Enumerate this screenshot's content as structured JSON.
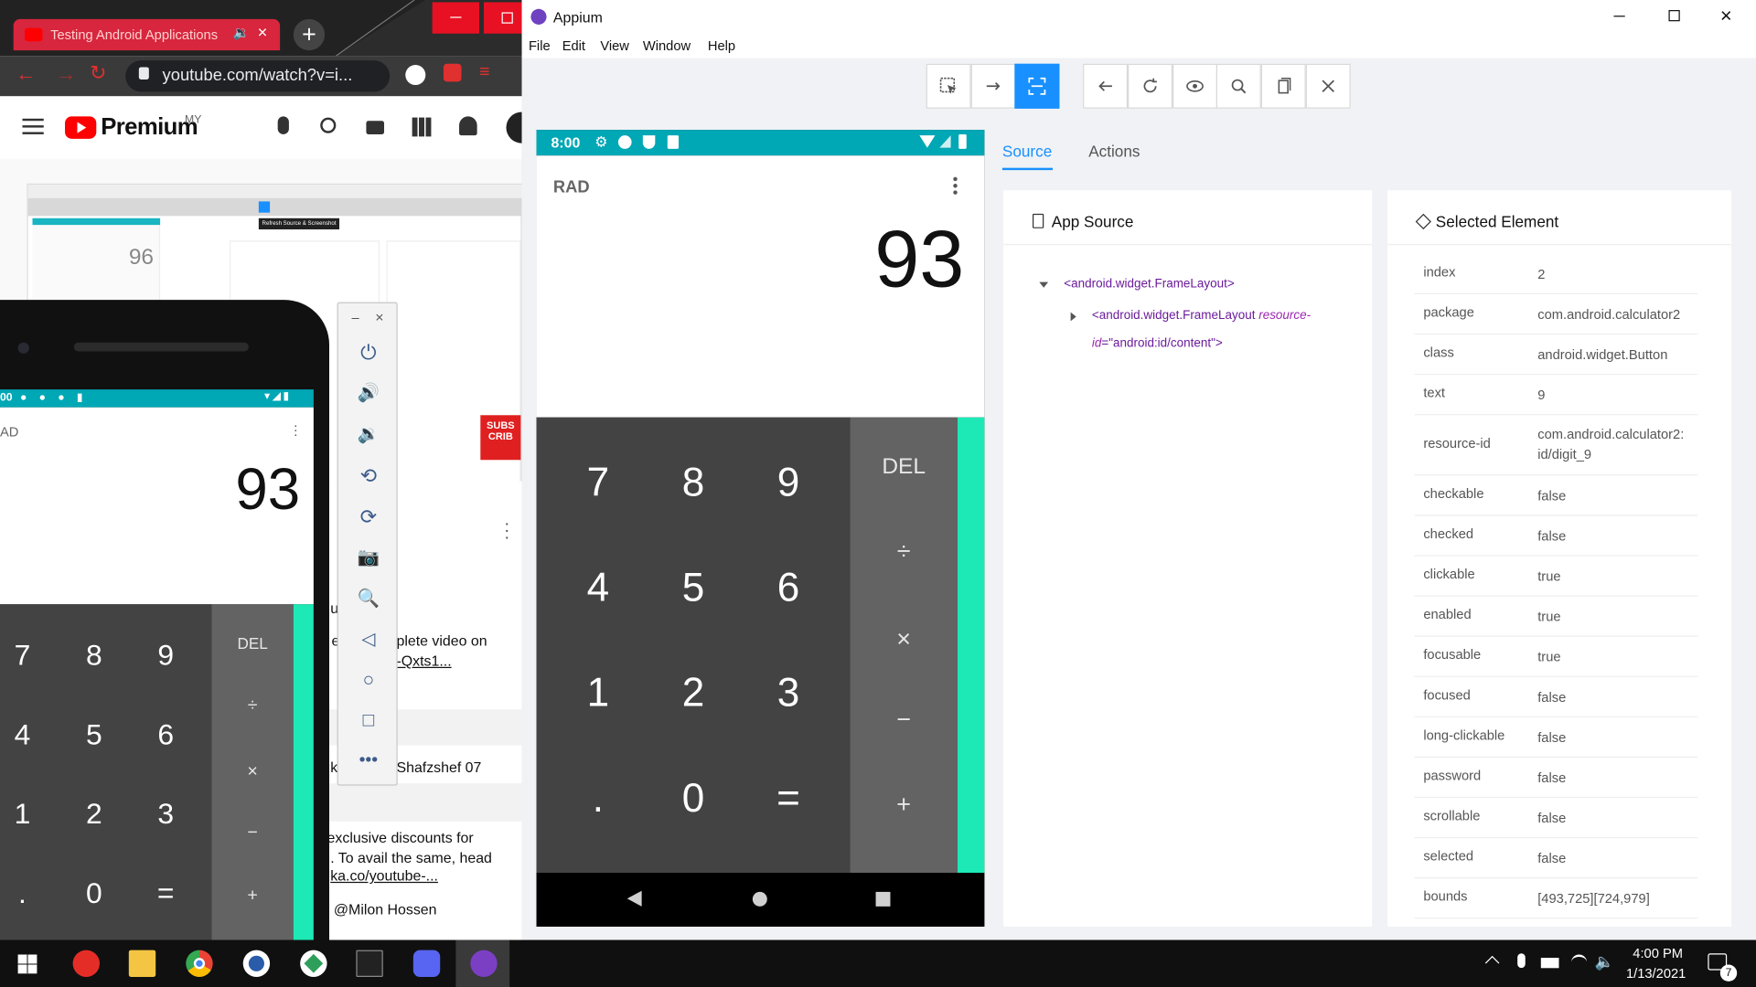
{
  "browser": {
    "tab_title": "Testing Android Applications",
    "url": "youtube.com/watch?v=i...",
    "brand": "Premium",
    "region": "MY",
    "thumbnail_number": "96",
    "thumb_tooltip": "Refresh Source & Screenshot",
    "video_text_1": "plete video on",
    "video_text_2": "-Qxts1...",
    "comment_author": "Shafzshef 07",
    "desc_1": "exclusive discounts for",
    "desc_2": ". To avail the same, head",
    "desc_3": "ka.co/youtube-...",
    "desc_4": "@Milon Hossen",
    "partial_u": "u",
    "partial_e": "e",
    "partial_k": "k",
    "subscribe_badge": "SUBS CRIB"
  },
  "emulator": {
    "status_time": "00",
    "mode": "AD",
    "display": "93",
    "digits": [
      "7",
      "8",
      "9",
      "4",
      "5",
      "6",
      "1",
      "2",
      "3",
      ".",
      "0",
      "="
    ],
    "ops": [
      "DEL",
      "÷",
      "×",
      "−",
      "+"
    ],
    "tools": [
      "power-icon",
      "volume-up-icon",
      "volume-down-icon",
      "rotate-left-icon",
      "rotate-right-icon",
      "camera-icon",
      "zoom-icon",
      "back-icon",
      "home-icon",
      "overview-icon",
      "more-icon"
    ]
  },
  "appium": {
    "window_title": "Appium",
    "menu": [
      "File",
      "Edit",
      "View",
      "Window",
      "Help"
    ],
    "toolbar": [
      "select-element-icon",
      "swipe-icon",
      "tap-coordinates-icon",
      "back-icon",
      "refresh-icon",
      "show-eye-icon",
      "search-icon",
      "copy-xml-icon",
      "quit-session-icon"
    ],
    "device": {
      "time": "8:00",
      "mode": "RAD",
      "display": "93",
      "digits": [
        "7",
        "8",
        "9",
        "4",
        "5",
        "6",
        "1",
        "2",
        "3",
        ".",
        "0",
        "="
      ],
      "ops": [
        "DEL",
        "÷",
        "×",
        "−",
        "+"
      ]
    },
    "tabs": {
      "source": "Source",
      "actions": "Actions"
    },
    "app_source": {
      "title": "App Source",
      "node1": "<android.widget.FrameLayout>",
      "node2_tag": "<android.widget.FrameLayout",
      "node2_attr": "resource-",
      "node2_attr2": "id",
      "node2_value": "=\"android:id/content\">"
    },
    "selected_element": {
      "title": "Selected Element",
      "attributes": [
        {
          "k": "index",
          "v": "2"
        },
        {
          "k": "package",
          "v": "com.android.calculator2"
        },
        {
          "k": "class",
          "v": "android.widget.Button"
        },
        {
          "k": "text",
          "v": "9"
        },
        {
          "k": "resource-id",
          "v": "com.android.calculator2:\nid/digit_9"
        },
        {
          "k": "checkable",
          "v": "false"
        },
        {
          "k": "checked",
          "v": "false"
        },
        {
          "k": "clickable",
          "v": "true"
        },
        {
          "k": "enabled",
          "v": "true"
        },
        {
          "k": "focusable",
          "v": "true"
        },
        {
          "k": "focused",
          "v": "false"
        },
        {
          "k": "long-clickable",
          "v": "false"
        },
        {
          "k": "password",
          "v": "false"
        },
        {
          "k": "scrollable",
          "v": "false"
        },
        {
          "k": "selected",
          "v": "false"
        },
        {
          "k": "bounds",
          "v": "[493,725][724,979]"
        }
      ]
    }
  },
  "taskbar": {
    "time": "4:00 PM",
    "date": "1/13/2021",
    "notifications": "7"
  },
  "colors": {
    "accent": "#1890ff",
    "teal": "#00a7b5",
    "mint": "#1de9b6",
    "yt_red": "#ff0000"
  }
}
